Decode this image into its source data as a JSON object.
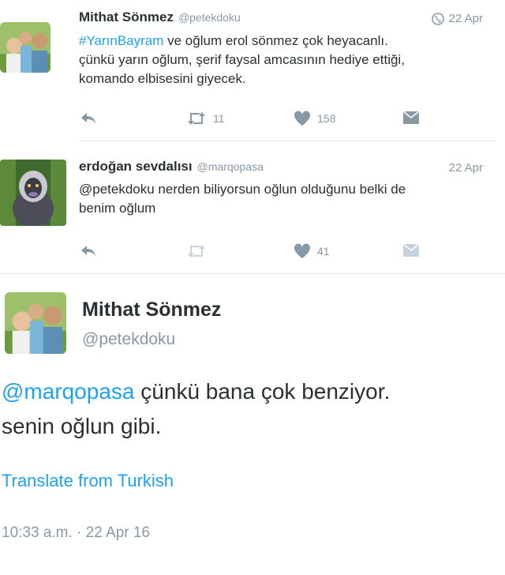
{
  "tweets": [
    {
      "name": "Mithat Sönmez",
      "handle": "@petekdoku",
      "date": "22 Apr",
      "hashtag": "#YarınBayram",
      "text_after_hashtag": " ve oğlum erol sönmez çok heyacanlı.",
      "text_line2": "çünkü yarın oğlum, şerif faysal amcasının hediye ettiği,",
      "text_line3": "komando elbisesini giyecek.",
      "retweets": "11",
      "likes": "158"
    },
    {
      "name": "erdoğan sevdalısı",
      "handle": "@marqopasa",
      "date": "22 Apr",
      "text_line1": "@petekdoku nerden biliyorsun oğlun olduğunu belki de",
      "text_line2": "benim oğlum",
      "likes": "41"
    }
  ],
  "detail": {
    "name": "Mithat Sönmez",
    "handle": "@petekdoku",
    "mention": "@marqopasa",
    "text_line1_rest": " çünkü bana çok benziyor.",
    "text_line2": "senin oğlun gibi.",
    "translate_label": "Translate from Turkish",
    "timestamp": "10:33 a.m. · 22 Apr 16"
  },
  "colors": {
    "accent": "#1da1f2",
    "muted": "#8899a6",
    "text": "#292f33"
  },
  "icons": [
    "reply-icon",
    "retweet-icon",
    "heart-icon",
    "direct-message-icon",
    "globe-icon"
  ]
}
